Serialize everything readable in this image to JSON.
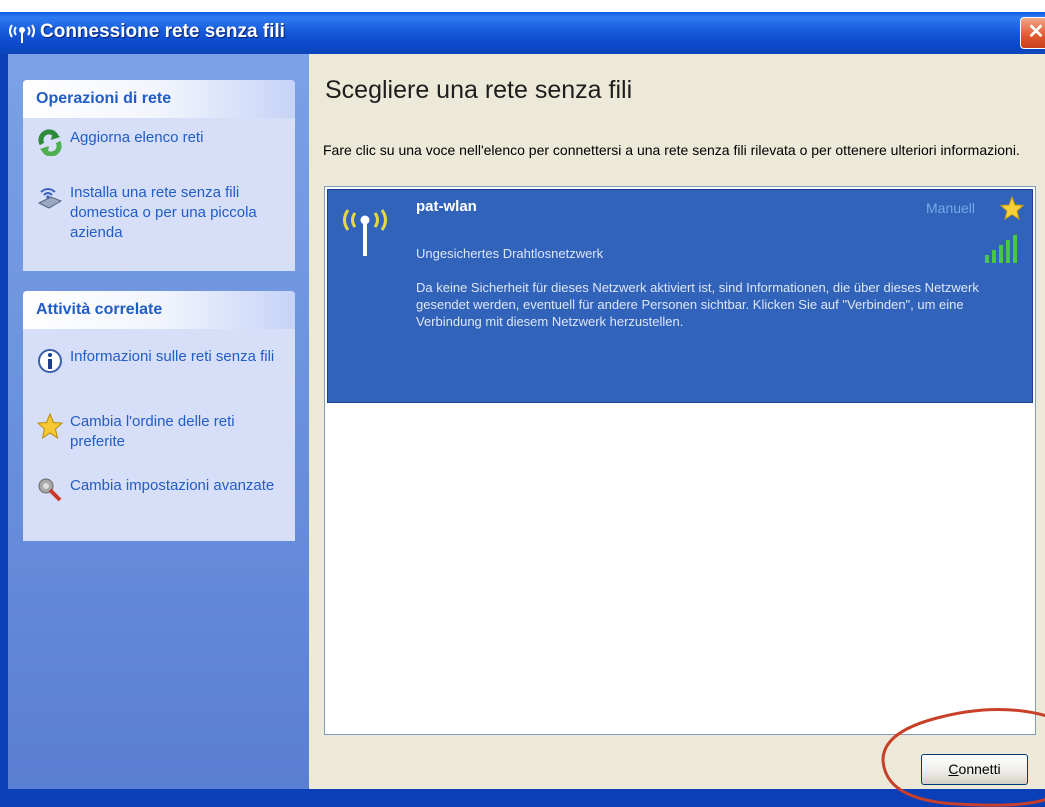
{
  "window": {
    "title": "Connessione rete senza fili",
    "close_symbol": "✕"
  },
  "sidebar": {
    "network_tasks": {
      "title": "Operazioni di rete",
      "items": [
        {
          "label": "Aggiorna elenco reti",
          "icon": "refresh-icon"
        },
        {
          "label": "Installa una rete senza fili domestica o per una piccola azienda",
          "icon": "network-setup-icon"
        }
      ]
    },
    "related_tasks": {
      "title": "Attività correlate",
      "items": [
        {
          "label": "Informazioni sulle reti senza fili",
          "icon": "info-icon"
        },
        {
          "label": "Cambia l'ordine delle reti preferite",
          "icon": "star-icon"
        },
        {
          "label": "Cambia impostazioni avanzate",
          "icon": "settings-icon"
        }
      ]
    }
  },
  "main": {
    "heading": "Scegliere una rete senza fili",
    "instruction": "Fare clic su una voce nell'elenco per connettersi a una rete senza fili rilevata o per ottenere ulteriori informazioni.",
    "networks": [
      {
        "ssid": "pat-wlan",
        "mode": "Manuell",
        "security": "Ungesichertes Drahtlosnetzwerk",
        "description": "Da keine Sicherheit für dieses Netzwerk aktiviert ist, sind Informationen, die über dieses Netzwerk gesendet werden, eventuell für andere Personen sichtbar. Klicken Sie auf \"Verbinden\", um eine Verbindung mit diesem Netzwerk herzustellen.",
        "signal_bars": 5,
        "selected": true
      }
    ],
    "connect_button": {
      "accesskey": "C",
      "label_rest": "onnetti"
    }
  },
  "colors": {
    "titlebar": "#0a5ae0",
    "sidebar": "#6d94df",
    "selection": "#3063b9",
    "link": "#215dc6",
    "annotation": "#c8402a"
  }
}
